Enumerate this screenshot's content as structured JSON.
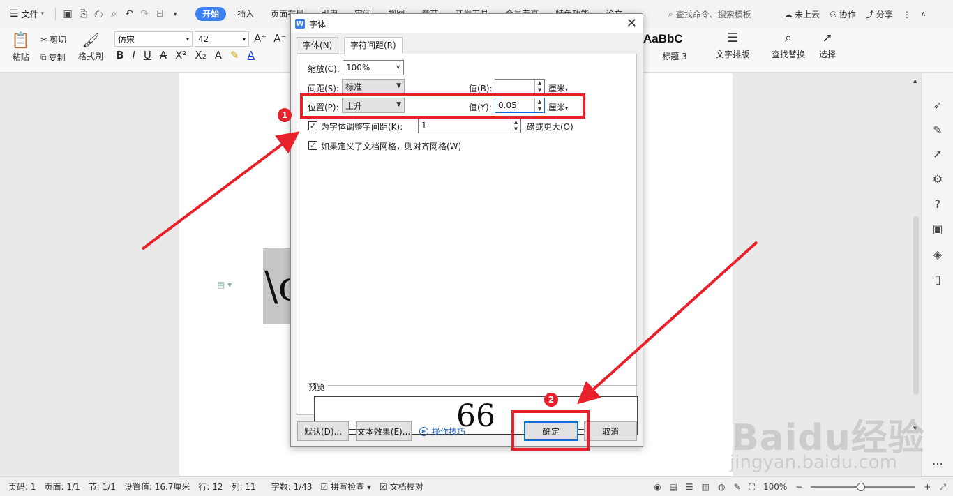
{
  "menubar": {
    "file_label": "文件",
    "tabs": [
      "开始",
      "插入",
      "页面布局",
      "引用",
      "审阅",
      "视图",
      "章节",
      "开发工具",
      "会员专享",
      "特色功能",
      "论文"
    ],
    "search_placeholder": "查找命令、搜索模板",
    "cloud_label": "未上云",
    "collab_label": "协作",
    "share_label": "分享"
  },
  "ribbon": {
    "paste": "粘贴",
    "cut": "剪切",
    "copy": "复制",
    "format_painter": "格式刷",
    "font_name": "仿宋",
    "font_size": "42",
    "style_preview": "AaBbC",
    "style_name": "标题 3",
    "text_layout": "文字排版",
    "find_replace": "查找替换",
    "select": "选择"
  },
  "document": {
    "selected_text": "\\c"
  },
  "dialog": {
    "title": "字体",
    "tabs": [
      "字体(N)",
      "字符间距(R)"
    ],
    "scale_label": "缩放(C):",
    "scale_value": "100%",
    "spacing_label": "间距(S):",
    "spacing_value": "标准",
    "spacing_val_label": "值(B):",
    "spacing_val": "",
    "position_label": "位置(P):",
    "position_value": "上升",
    "position_val_label": "值(Y):",
    "position_val": "0.05",
    "unit": "厘米",
    "kerning_label": "为字体调整字间距(K):",
    "kerning_value": "1",
    "kerning_suffix": "磅或更大(O)",
    "grid_label": "如果定义了文档网格，则对齐网格(W)",
    "preview_label": "预览",
    "preview_text": "66",
    "btn_default": "默认(D)...",
    "btn_effects": "文本效果(E)...",
    "tips": "操作技巧",
    "btn_ok": "确定",
    "btn_cancel": "取消"
  },
  "annotations": {
    "badge1": "1",
    "badge2": "2",
    "color": "#e8202a"
  },
  "statusbar": {
    "page_num": "页码: 1",
    "pages": "页面: 1/1",
    "section": "节: 1/1",
    "setting": "设置值: 16.7厘米",
    "row": "行: 12",
    "col": "列: 11",
    "words": "字数: 1/43",
    "spell": "拼写检查",
    "doc_check": "文档校对",
    "zoom": "100%"
  },
  "watermark": {
    "main": "Baidu经验",
    "sub": "jingyan.baidu.com"
  },
  "colors": {
    "accent": "#3c82f2",
    "annotation": "#e8202a"
  }
}
